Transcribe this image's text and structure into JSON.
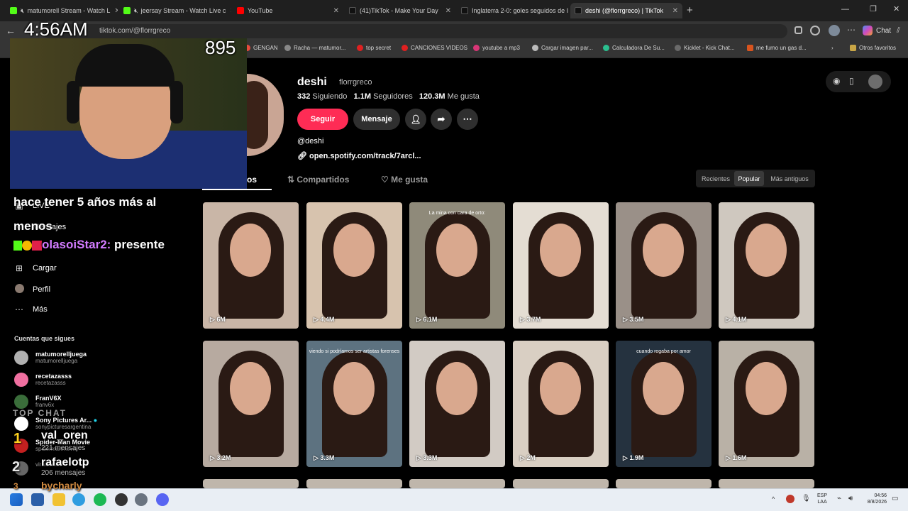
{
  "tabs": [
    {
      "label": "matumorell Stream - Watch L",
      "color": "#53fc18"
    },
    {
      "label": "jeersay Stream - Watch Live c",
      "color": "#53fc18"
    },
    {
      "label": "YouTube",
      "color": "#ff0000"
    },
    {
      "label": "(41)TikTok - Make Your Day",
      "color": "#111111"
    },
    {
      "label": "Inglaterra 2-0: goles seguidos de I",
      "color": "#111111"
    },
    {
      "label": "deshi (@florrgreco) | TikTok",
      "color": "#111111"
    }
  ],
  "address": {
    "url": "tiktok.com/@florrgreco"
  },
  "browser": {
    "chat_label": "Chat",
    "other_bookmarks": "Otros favoritos"
  },
  "bookmarks": [
    {
      "label": "GENGAN",
      "color": "#e84b3c"
    },
    {
      "label": "Racha — matumor...",
      "color": "#888888"
    },
    {
      "label": "top secret",
      "color": "#e02020"
    },
    {
      "label": "CANCIONES VIDEOS",
      "color": "#e02020"
    },
    {
      "label": "youtube a mp3",
      "color": "#d93677"
    },
    {
      "label": "Cargar imagen par...",
      "color": "#bbbbbb"
    },
    {
      "label": "Calculadora De Su...",
      "color": "#2bbf8f"
    },
    {
      "label": "Kicklet - Kick Chat...",
      "color": "#6a6a6a"
    },
    {
      "label": "me fumo un gas d...",
      "color": "#d9541e"
    }
  ],
  "profile": {
    "name": "deshi",
    "username": "florrgreco",
    "following_count": "332",
    "following_label": "Siguiendo",
    "followers_count": "1.1M",
    "followers_label": "Seguidores",
    "likes_count": "120.3M",
    "likes_label": "Me gusta",
    "follow_button": "Seguir",
    "message_button": "Mensaje",
    "bio": "@deshi",
    "link": "open.spotify.com/track/7arcl..."
  },
  "content_tabs": {
    "videos": "os",
    "reposts": "Compartidos",
    "liked": "Me gusta"
  },
  "sort": {
    "recent": "Recientes",
    "popular": "Popular",
    "oldest": "Más antiguos"
  },
  "sidebar": {
    "items": [
      {
        "label": "LIVE",
        "icon": "live-icon"
      },
      {
        "label": "Mensajes",
        "icon": "messages-icon"
      },
      {
        "label": "Cargar",
        "icon": "upload-icon"
      },
      {
        "label": "Perfil",
        "icon": "profile-icon"
      },
      {
        "label": "Más",
        "icon": "more-icon"
      }
    ],
    "following_title": "Cuentas que sigues",
    "following": [
      {
        "name": "matumorelljuega",
        "handle": "matumorelljuega",
        "color": "#b0b0b0"
      },
      {
        "name": "recetazasss",
        "handle": "recetazasss",
        "color": "#f06fa0"
      },
      {
        "name": "FranV6X",
        "handle": "franv6x",
        "color": "#3a6d3a"
      },
      {
        "name": "Sony Pictures Ar...",
        "handle": "sonypicturesargentina",
        "color": "#ffffff"
      },
      {
        "name": "Spider-Man Movie",
        "handle": "spidermanmovie",
        "color": "#c42020"
      },
      {
        "name": "",
        "handle": "viralcomm",
        "color": "#666666"
      }
    ]
  },
  "videos": [
    {
      "views": "6M",
      "bg": "#c9b6a7",
      "caption": ""
    },
    {
      "views": "4.4M",
      "bg": "#d7c3ae",
      "caption": ""
    },
    {
      "views": "6.1M",
      "bg": "#8f8a7a",
      "caption": "La mina con cara de orto:"
    },
    {
      "views": "3.7M",
      "bg": "#e4ddd3",
      "caption": ""
    },
    {
      "views": "3.5M",
      "bg": "#9a9088",
      "caption": ""
    },
    {
      "views": "4.1M",
      "bg": "#cfc8bf",
      "caption": ""
    },
    {
      "views": "3.2M",
      "bg": "#b7aaa0",
      "caption": ""
    },
    {
      "views": "3.3M",
      "bg": "#5d7280",
      "caption": "viendo si podríamos ser artistas forenses"
    },
    {
      "views": "3.3M",
      "bg": "#d2cbc4",
      "caption": ""
    },
    {
      "views": "2M",
      "bg": "#d9cfc3",
      "caption": ""
    },
    {
      "views": "1.9M",
      "bg": "#25323f",
      "caption": "cuando rogaba por amor"
    },
    {
      "views": "1.6M",
      "bg": "#b9b1a6",
      "caption": ""
    }
  ],
  "overlay": {
    "time": "4:56AM",
    "viewer_count": "895",
    "chat_message": "hace tener 5 años más al menos",
    "chat_user": "olasoiStar2:",
    "chat_text": "presente",
    "top_chat_title": "TOP CHAT",
    "top_chat": [
      {
        "rank": "1",
        "name": "val_oren",
        "count": "221 mensajes"
      },
      {
        "rank": "2",
        "name": "rafaelotp",
        "count": "206 mensajes"
      },
      {
        "rank": "3",
        "name": "bycharly",
        "count": ""
      }
    ]
  },
  "taskbar": {
    "lang1": "ESP",
    "lang2": "LAA",
    "time": "04:56",
    "date": "8/8/2026"
  }
}
